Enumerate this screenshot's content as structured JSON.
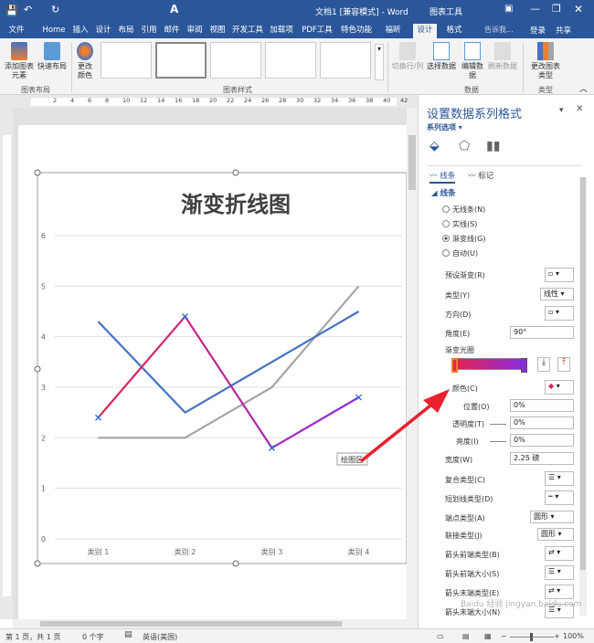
{
  "titlebar": {
    "doc_title": "文档1 [兼容模式] - Word",
    "context_group": "图表工具",
    "login": "登录",
    "share": "共享"
  },
  "tabs": [
    "文件",
    "Home",
    "插入",
    "设计",
    "布局",
    "引用",
    "邮件",
    "审阅",
    "视图",
    "开发工具",
    "加载项",
    "PDF工具集",
    "特色功能",
    "福昕PDF",
    "设计",
    "格式"
  ],
  "tell_me": "告诉我...",
  "ribbon": {
    "add_element": "添加图表元素",
    "quick_layout": "快速布局",
    "change_colors": "更改颜色",
    "group_layout": "图表布局",
    "group_styles": "图表样式",
    "switch_rowcol": "切换行/列",
    "select_data": "选择数据",
    "edit_data": "编辑数据",
    "refresh_data": "刷新数据",
    "group_data": "数据",
    "change_type": "更改图表类型",
    "group_type": "类型"
  },
  "ruler_ticks": [
    "2",
    "4",
    "6",
    "8",
    "10",
    "12",
    "14",
    "16",
    "18",
    "20",
    "22",
    "24",
    "26",
    "28",
    "30",
    "32",
    "34",
    "36",
    "38",
    "40",
    "42"
  ],
  "chart_data": {
    "type": "line",
    "title": "渐变折线图",
    "categories": [
      "类别 1",
      "类别 2",
      "类别 3",
      "类别 4"
    ],
    "series": [
      {
        "values": [
          4.3,
          2.5,
          3.5,
          4.5
        ],
        "color": "#4472c4"
      },
      {
        "values": [
          2.4,
          4.4,
          1.8,
          2.8
        ],
        "color": "#e8224d"
      },
      {
        "values": [
          2.0,
          2.0,
          3.0,
          5.0
        ],
        "color": "#a5a5a5"
      }
    ],
    "yticks": [
      "0",
      "1",
      "2",
      "3",
      "4",
      "5",
      "6"
    ],
    "ylim": [
      0,
      6
    ],
    "grid": true,
    "tooltip": "绘图区"
  },
  "pane": {
    "title": "设置数据系列格式",
    "series_options": "系列选项",
    "tab_line": "线条",
    "tab_marker": "标记",
    "section_line": "线条",
    "radio": [
      "无线条(N)",
      "实线(S)",
      "渐变线(G)",
      "自动(U)"
    ],
    "preset": "预设渐变(R)",
    "type": "类型(Y)",
    "type_value": "线性",
    "direction": "方向(D)",
    "angle": "角度(E)",
    "angle_value": "90°",
    "gradient_stops": "渐变光圈",
    "color": "颜色(C)",
    "position": "位置(O)",
    "position_value": "0%",
    "transparency": "透明度(T)",
    "transparency_value": "0%",
    "brightness": "亮度(I)",
    "brightness_value": "0%",
    "width": "宽度(W)",
    "width_value": "2.25 磅",
    "compound": "复合类型(C)",
    "dash": "短划线类型(D)",
    "cap": "端点类型(A)",
    "cap_value": "圆形",
    "join": "联接类型(J)",
    "join_value": "圆形",
    "begin_arrow_type": "箭头前端类型(B)",
    "begin_arrow_size": "箭头前端大小(S)",
    "end_arrow_type": "箭头末端类型(E)",
    "end_arrow_size": "箭头末端大小(N)"
  },
  "status": {
    "page": "第 1 页，共 1 页",
    "words": "0 个字",
    "lang": "英语(美国)",
    "zoom": "100%"
  },
  "watermark": "Baidu 经验 jingyan.baidu.com"
}
